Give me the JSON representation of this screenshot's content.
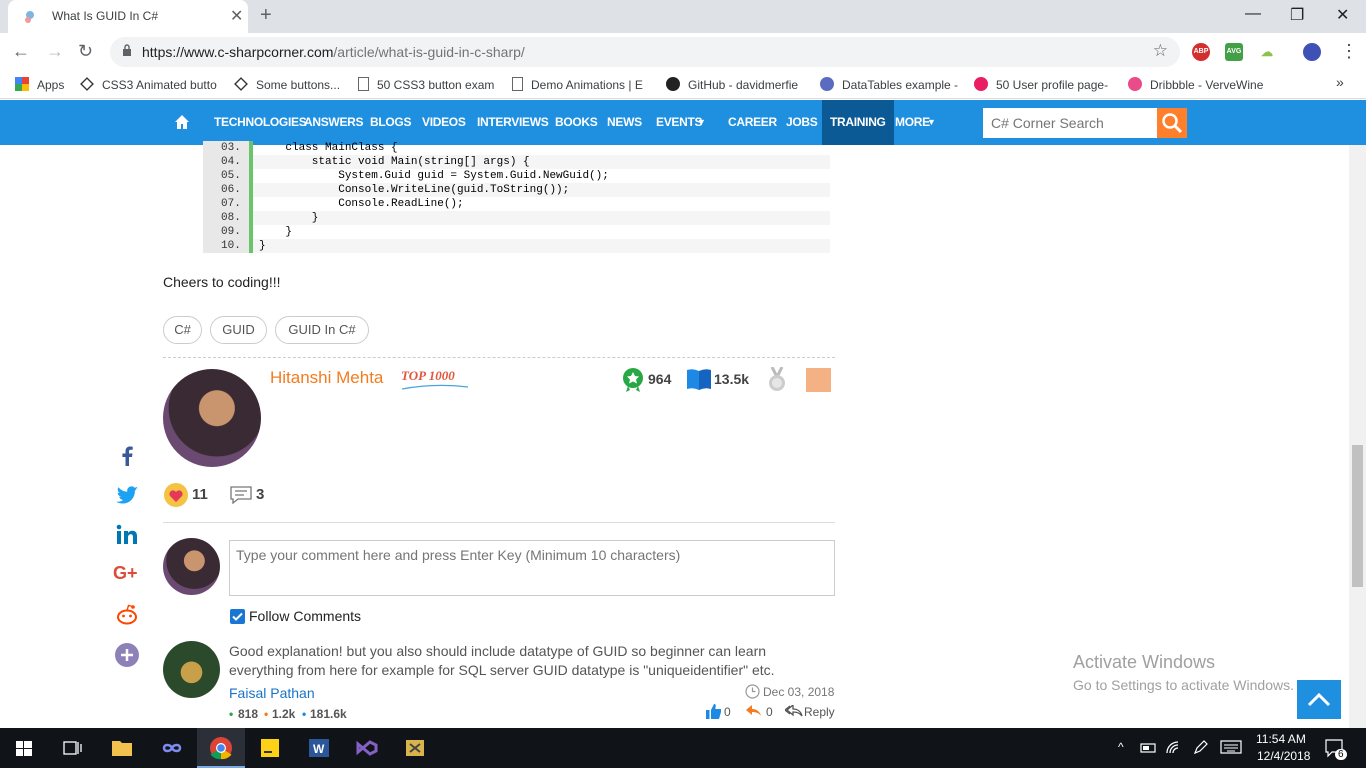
{
  "browser": {
    "tab_title": "What Is GUID In C#",
    "url_host": "https://www.c-sharpcorner.com",
    "url_path": "/article/what-is-guid-in-c-sharp/",
    "bookmarks": [
      "Apps",
      "CSS3 Animated butto",
      "Some buttons...",
      "50 CSS3 button exam",
      "Demo Animations | E",
      "GitHub - davidmerfie",
      "DataTables example -",
      "50 User profile page-",
      "Dribbble - VerveWine"
    ],
    "extensions": [
      "ABP",
      "AVG"
    ],
    "more_bookmarks": "»"
  },
  "site_nav": {
    "items": [
      "TECHNOLOGIES",
      "ANSWERS",
      "BLOGS",
      "VIDEOS",
      "INTERVIEWS",
      "BOOKS",
      "NEWS",
      "EVENTS",
      "CAREER",
      "JOBS",
      "TRAINING",
      "MORE"
    ],
    "search_placeholder": "C# Corner Search",
    "active_item": "TRAINING"
  },
  "code": {
    "lines": [
      {
        "num": "03.",
        "text": "    class MainClass {"
      },
      {
        "num": "04.",
        "text": "        static void Main(string[] args) {"
      },
      {
        "num": "05.",
        "text": "            System.Guid guid = System.Guid.NewGuid();"
      },
      {
        "num": "06.",
        "text": "            Console.WriteLine(guid.ToString());"
      },
      {
        "num": "07.",
        "text": "            Console.ReadLine();"
      },
      {
        "num": "08.",
        "text": "        }"
      },
      {
        "num": "09.",
        "text": "    }"
      },
      {
        "num": "10.",
        "text": "}"
      }
    ]
  },
  "article": {
    "closing": "Cheers to coding!!!",
    "tags": [
      "C#",
      "GUID",
      "GUID In C#"
    ]
  },
  "author": {
    "name": "Hitanshi Mehta",
    "rank": "TOP 1000",
    "points": "964",
    "reads": "13.5k",
    "likes": "11",
    "comments": "3"
  },
  "comment_form": {
    "placeholder": "Type your comment here and press Enter Key (Minimum 10 characters)",
    "follow_label": "Follow Comments",
    "follow_checked": true
  },
  "comment": {
    "text": "Good explanation! but you also should include datatype of GUID so beginner can learn everything from here for example for SQL server GUID datatype is \"uniqueidentifier\" etc.",
    "author": "Faisal Pathan",
    "date": "Dec 03, 2018",
    "stats": [
      "818",
      "1.2k",
      "181.6k"
    ],
    "likes": "0",
    "replies": "0",
    "reply_label": "Reply"
  },
  "windows": {
    "activate_title": "Activate Windows",
    "activate_sub": "Go to Settings to activate Windows.",
    "time": "11:54 AM",
    "date": "12/4/2018",
    "notifications": "6"
  },
  "colors": {
    "nav_blue": "#1f8fe0",
    "nav_active": "#0c5a95",
    "accent_orange": "#f47b20",
    "link_blue": "#1a73c8"
  }
}
